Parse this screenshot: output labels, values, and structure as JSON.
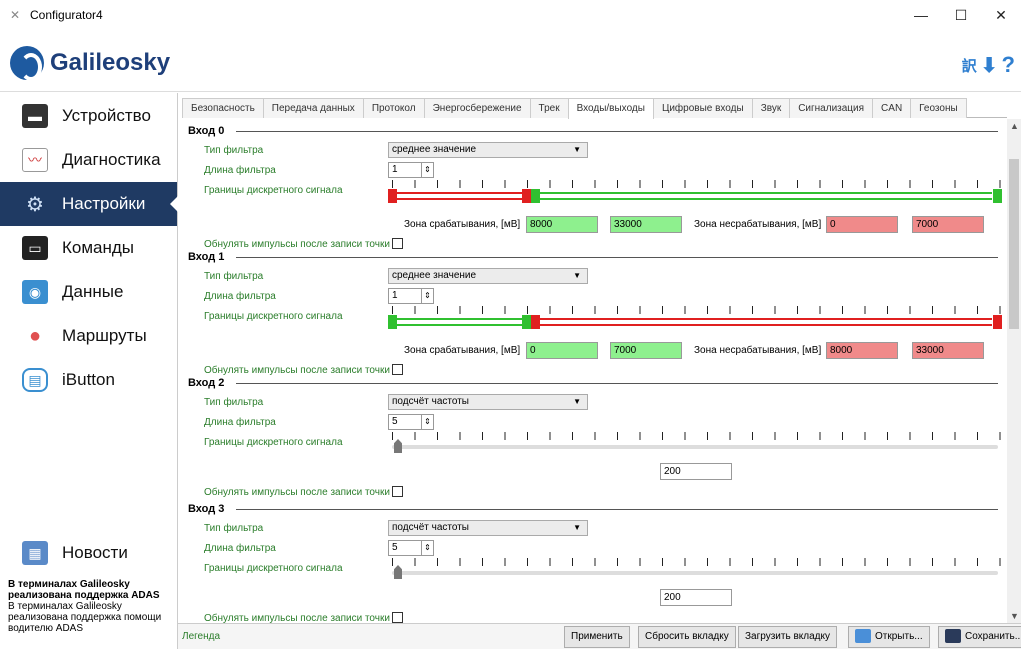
{
  "window": {
    "title": "Configurator4",
    "controls": [
      "—",
      "☐",
      "✕"
    ]
  },
  "logo_text": "Galileosky",
  "header_icons": [
    "translate-icon",
    "download-icon",
    "help-icon"
  ],
  "sidebar": {
    "items": [
      {
        "label": "Устройство",
        "icon": "device-icon"
      },
      {
        "label": "Диагностика",
        "icon": "chart-icon"
      },
      {
        "label": "Настройки",
        "icon": "gear-icon",
        "active": true
      },
      {
        "label": "Команды",
        "icon": "terminal-icon"
      },
      {
        "label": "Данные",
        "icon": "data-icon"
      },
      {
        "label": "Маршруты",
        "icon": "map-pin-icon"
      },
      {
        "label": "iButton",
        "icon": "ibutton-icon"
      }
    ],
    "news": {
      "label": "Новости",
      "headline": "В терминалах Galileosky реализована поддержка ADAS",
      "body": "В терминалах Galileosky реализована поддержка помощи водителю ADAS"
    }
  },
  "tabs": [
    "Безопасность",
    "Передача данных",
    "Протокол",
    "Энергосбережение",
    "Трек",
    "Входы/выходы",
    "Цифровые входы",
    "Звук",
    "Сигнализация",
    "CAN",
    "Геозоны"
  ],
  "active_tab": "Входы/выходы",
  "labels": {
    "filter_type": "Тип фильтра",
    "filter_length": "Длина фильтра",
    "discrete_bounds": "Границы дискретного сигнала",
    "trigger_zone": "Зона срабатывания, [мВ]",
    "non_trigger_zone": "Зона несрабатывания, [мВ]",
    "reset_pulses": "Обнулять импульсы после записи точки"
  },
  "inputs": [
    {
      "title": "Вход 0",
      "filter": "среднее значение",
      "length": "1",
      "trigger_from": "8000",
      "trigger_to": "33000",
      "nontrigger_from": "0",
      "nontrigger_to": "7000"
    },
    {
      "title": "Вход 1",
      "filter": "среднее значение",
      "length": "1",
      "trigger_from": "0",
      "trigger_to": "7000",
      "nontrigger_from": "8000",
      "nontrigger_to": "33000"
    },
    {
      "title": "Вход 2",
      "filter": "подсчёт частоты",
      "length": "5",
      "value": "200"
    },
    {
      "title": "Вход 3",
      "filter": "подсчёт частоты",
      "length": "5",
      "value": "200"
    }
  ],
  "bottom": {
    "legend": "Легенда",
    "apply": "Применить",
    "reset_tab": "Сбросить вкладку",
    "load_tab": "Загрузить вкладку",
    "open": "Открыть...",
    "save": "Сохранить..."
  }
}
